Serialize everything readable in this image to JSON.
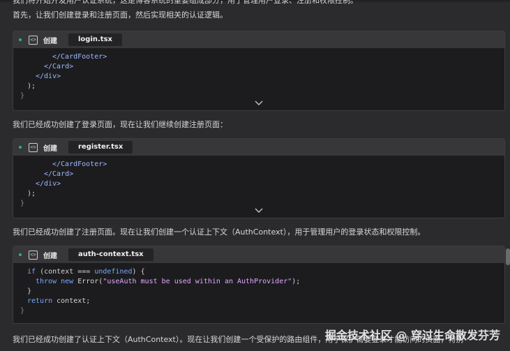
{
  "paragraphs": {
    "p0": "我们将开始开发用户认证系统，这是博客系统的重要组成部分，用于管理用户登录、注册和权限控制。",
    "p1": "首先，让我们创建登录和注册页面，然后实现相关的认证逻辑。",
    "p2": "我们已经成功创建了登录页面，现在让我们继续创建注册页面：",
    "p3": "我们已经成功创建了注册页面。现在让我们创建一个认证上下文（AuthContext），用于管理用户的登录状态和权限控制。",
    "p4": "我们已经成功创建了认证上下文（AuthContext）。现在让我们创建一个受保护的路由组件，用于保护需要登录才能访问的页面，特别"
  },
  "cards": [
    {
      "action": "创建",
      "file": "login.tsx",
      "lines": [
        "    </CardFooter>",
        "  </Card>",
        "</div>",
        ");",
        "}"
      ]
    },
    {
      "action": "创建",
      "file": "register.tsx",
      "lines": [
        "    </CardFooter>",
        "  </Card>",
        "</div>",
        ");",
        "}"
      ]
    },
    {
      "action": "创建",
      "file": "auth-context.tsx",
      "lines": [
        "if (context === undefined) {",
        "  throw new Error(\"useAuth must be used within an AuthProvider\");",
        "}",
        "return context;",
        "}"
      ]
    }
  ],
  "icons": {
    "status": "status-dot-icon",
    "code": "code-file-icon",
    "expand": "chevron-down-icon"
  },
  "colors": {
    "background": "#2b2b2e",
    "card_header": "#37373a",
    "code_bg": "#1c1c1f",
    "status_green": "#2bb673"
  },
  "watermark": "掘金技术社区 @ 穿过生命散发芬芳"
}
